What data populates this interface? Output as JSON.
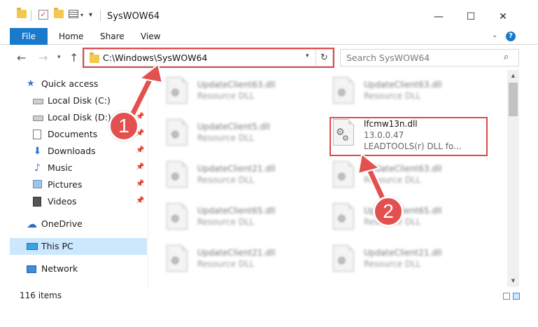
{
  "window": {
    "title": "SysWOW64",
    "minimize_glyph": "—",
    "maximize_glyph": "☐",
    "close_glyph": "✕"
  },
  "ribbon": {
    "tabs": [
      "File",
      "Home",
      "Share",
      "View"
    ]
  },
  "address": {
    "path": "C:\\Windows\\SysWOW64",
    "search_placeholder": "Search SysWOW64"
  },
  "nav_pane": {
    "items": [
      {
        "label": "Quick access",
        "icon": "star-icon"
      },
      {
        "label": "Local Disk (C:)",
        "icon": "drive-icon",
        "pinned": true
      },
      {
        "label": "Local Disk (D:)",
        "icon": "drive-icon",
        "pinned": true
      },
      {
        "label": "Documents",
        "icon": "documents-icon",
        "pinned": true
      },
      {
        "label": "Downloads",
        "icon": "downloads-icon",
        "pinned": true
      },
      {
        "label": "Music",
        "icon": "music-icon",
        "pinned": true
      },
      {
        "label": "Pictures",
        "icon": "pictures-icon",
        "pinned": true
      },
      {
        "label": "Videos",
        "icon": "videos-icon",
        "pinned": true
      },
      {
        "label": "OneDrive",
        "icon": "onedrive-icon"
      },
      {
        "label": "This PC",
        "icon": "this-pc-icon",
        "selected": true
      },
      {
        "label": "Network",
        "icon": "network-icon"
      }
    ]
  },
  "files": {
    "left_column": [
      {
        "name": "UpdateClient63.dll",
        "type": "Resource DLL"
      },
      {
        "name": "UpdateClient5.dll",
        "type": "Resource DLL"
      },
      {
        "name": "UpdateClient21.dll",
        "type": "Resource DLL"
      },
      {
        "name": "UpdateClient65.dll",
        "type": "Resource DLL"
      },
      {
        "name": "UpdateClient21.dll",
        "type": "Resource DLL"
      }
    ],
    "right_column": [
      {
        "name": "UpdateClient63.dll",
        "type": "Resource DLL"
      },
      {
        "name": "UpdateClient63.dll",
        "type": "Resource DLL"
      },
      {
        "name": "UpdateClient65.dll",
        "type": "Resource DLL"
      },
      {
        "name": "UpdateClient21.dll",
        "type": "Resource DLL"
      }
    ],
    "highlighted": {
      "name": "lfcmw13n.dll",
      "version": "13.0.0.47",
      "description": "LEADTOOLS(r) DLL fo..."
    }
  },
  "status": {
    "item_count": "116 items"
  },
  "annotations": {
    "step1": "1",
    "step2": "2",
    "accent_color": "#e04949"
  }
}
